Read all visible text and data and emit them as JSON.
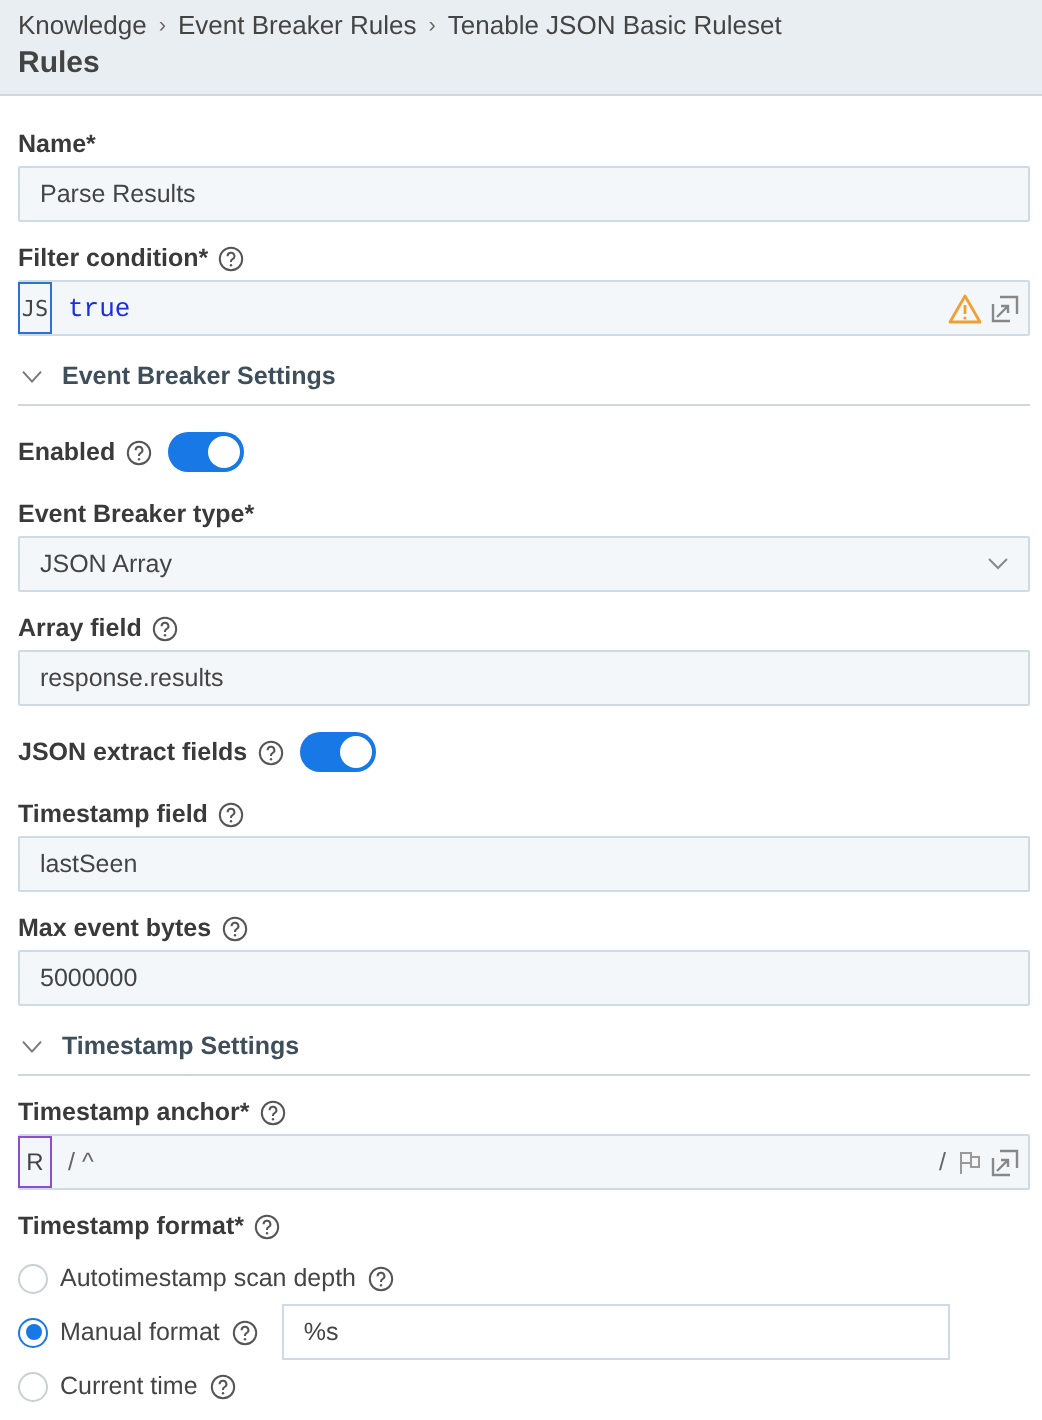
{
  "breadcrumb": [
    "Knowledge",
    "Event Breaker Rules",
    "Tenable JSON Basic Ruleset"
  ],
  "breadcrumb_separator": "›",
  "page_title": "Rules",
  "fields": [
    {
      "kind": "text",
      "label": "Name*",
      "help": false,
      "value": "Parse Results"
    },
    {
      "kind": "code",
      "label": "Filter condition*",
      "help": true,
      "badge": "JS",
      "value": "true",
      "warning": true
    },
    {
      "kind": "section",
      "title": "Event Breaker Settings",
      "expanded": true
    },
    {
      "kind": "toggle",
      "label": "Enabled",
      "help": true,
      "on": true
    },
    {
      "kind": "select",
      "label": "Event Breaker type*",
      "help": false,
      "value": "JSON Array"
    },
    {
      "kind": "text",
      "label": "Array field",
      "help": true,
      "value": "response.results"
    },
    {
      "kind": "toggle",
      "label": "JSON extract fields",
      "help": true,
      "on": true
    },
    {
      "kind": "text",
      "label": "Timestamp field",
      "help": true,
      "value": "lastSeen"
    },
    {
      "kind": "text",
      "label": "Max event bytes",
      "help": true,
      "value": "5000000"
    },
    {
      "kind": "section",
      "title": "Timestamp Settings",
      "expanded": true
    },
    {
      "kind": "regex",
      "label": "Timestamp anchor*",
      "help": true,
      "badge": "R",
      "value": "/ ^",
      "suffix": "/"
    },
    {
      "kind": "radio-group",
      "label": "Timestamp format*",
      "help": true,
      "options": [
        {
          "label": "Autotimestamp scan depth",
          "help": true,
          "selected": false
        },
        {
          "label": "Manual format",
          "help": true,
          "selected": true,
          "value": "%s"
        },
        {
          "label": "Current time",
          "help": true,
          "selected": false
        }
      ]
    }
  ]
}
